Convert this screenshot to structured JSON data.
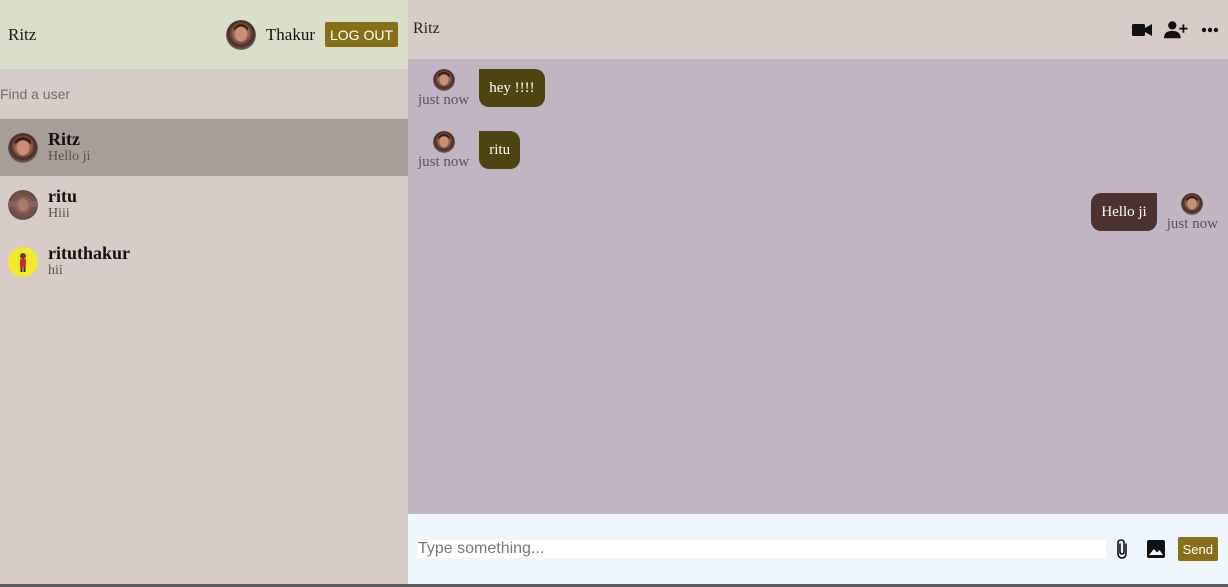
{
  "sidebar": {
    "logo": "Ritz",
    "current_user": {
      "name": "Thakur"
    },
    "logout_label": "LOG OUT",
    "search": {
      "placeholder": "Find a user",
      "value": ""
    },
    "chats": [
      {
        "name": "Ritz",
        "last_message": "Hello ji",
        "active": true
      },
      {
        "name": "ritu",
        "last_message": "Hiii",
        "active": false
      },
      {
        "name": "rituthakur",
        "last_message": "hii",
        "active": false
      }
    ]
  },
  "chat": {
    "title": "Ritz",
    "header_icons": [
      "video-camera-icon",
      "add-user-icon",
      "more-icon"
    ],
    "messages": [
      {
        "text": "hey !!!!",
        "time": "just now",
        "owner": false
      },
      {
        "text": "ritu",
        "time": "just now",
        "owner": false
      },
      {
        "text": "Hello ji",
        "time": "just now",
        "owner": true
      }
    ],
    "input": {
      "placeholder": "Type something...",
      "value": ""
    },
    "tools": [
      "attach-icon",
      "image-icon"
    ],
    "send_label": "Send"
  },
  "colors": {
    "accent": "#857018",
    "sidebar_bg": "#d8ccc8",
    "navbar_bg": "#d9dfc8",
    "active_chat_bg": "#a89f9b",
    "messages_bg": "#c1b5c4",
    "incoming_bubble": "#4d440f",
    "outgoing_bubble": "#4d3030",
    "input_bg": "#eef6fd"
  }
}
